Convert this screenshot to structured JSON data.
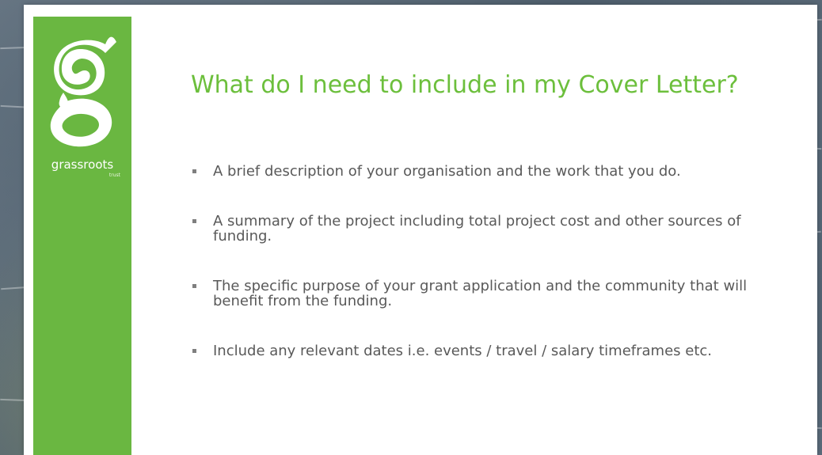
{
  "slide": {
    "title": "What do I need to include in my Cover Letter?",
    "logo": {
      "name": "grassroots",
      "subtext": "trust"
    },
    "bullets": [
      "A brief description of your organisation and the work that you do.",
      "A summary of the project including total project cost and other sources of funding.",
      "The specific purpose of your grant application and the community that will benefit from the funding.",
      "Include any relevant dates i.e. events / travel / salary timeframes etc."
    ]
  },
  "colors": {
    "brand_green": "#6ab741",
    "title_green": "#6cbf3c",
    "body_text": "#595959"
  }
}
